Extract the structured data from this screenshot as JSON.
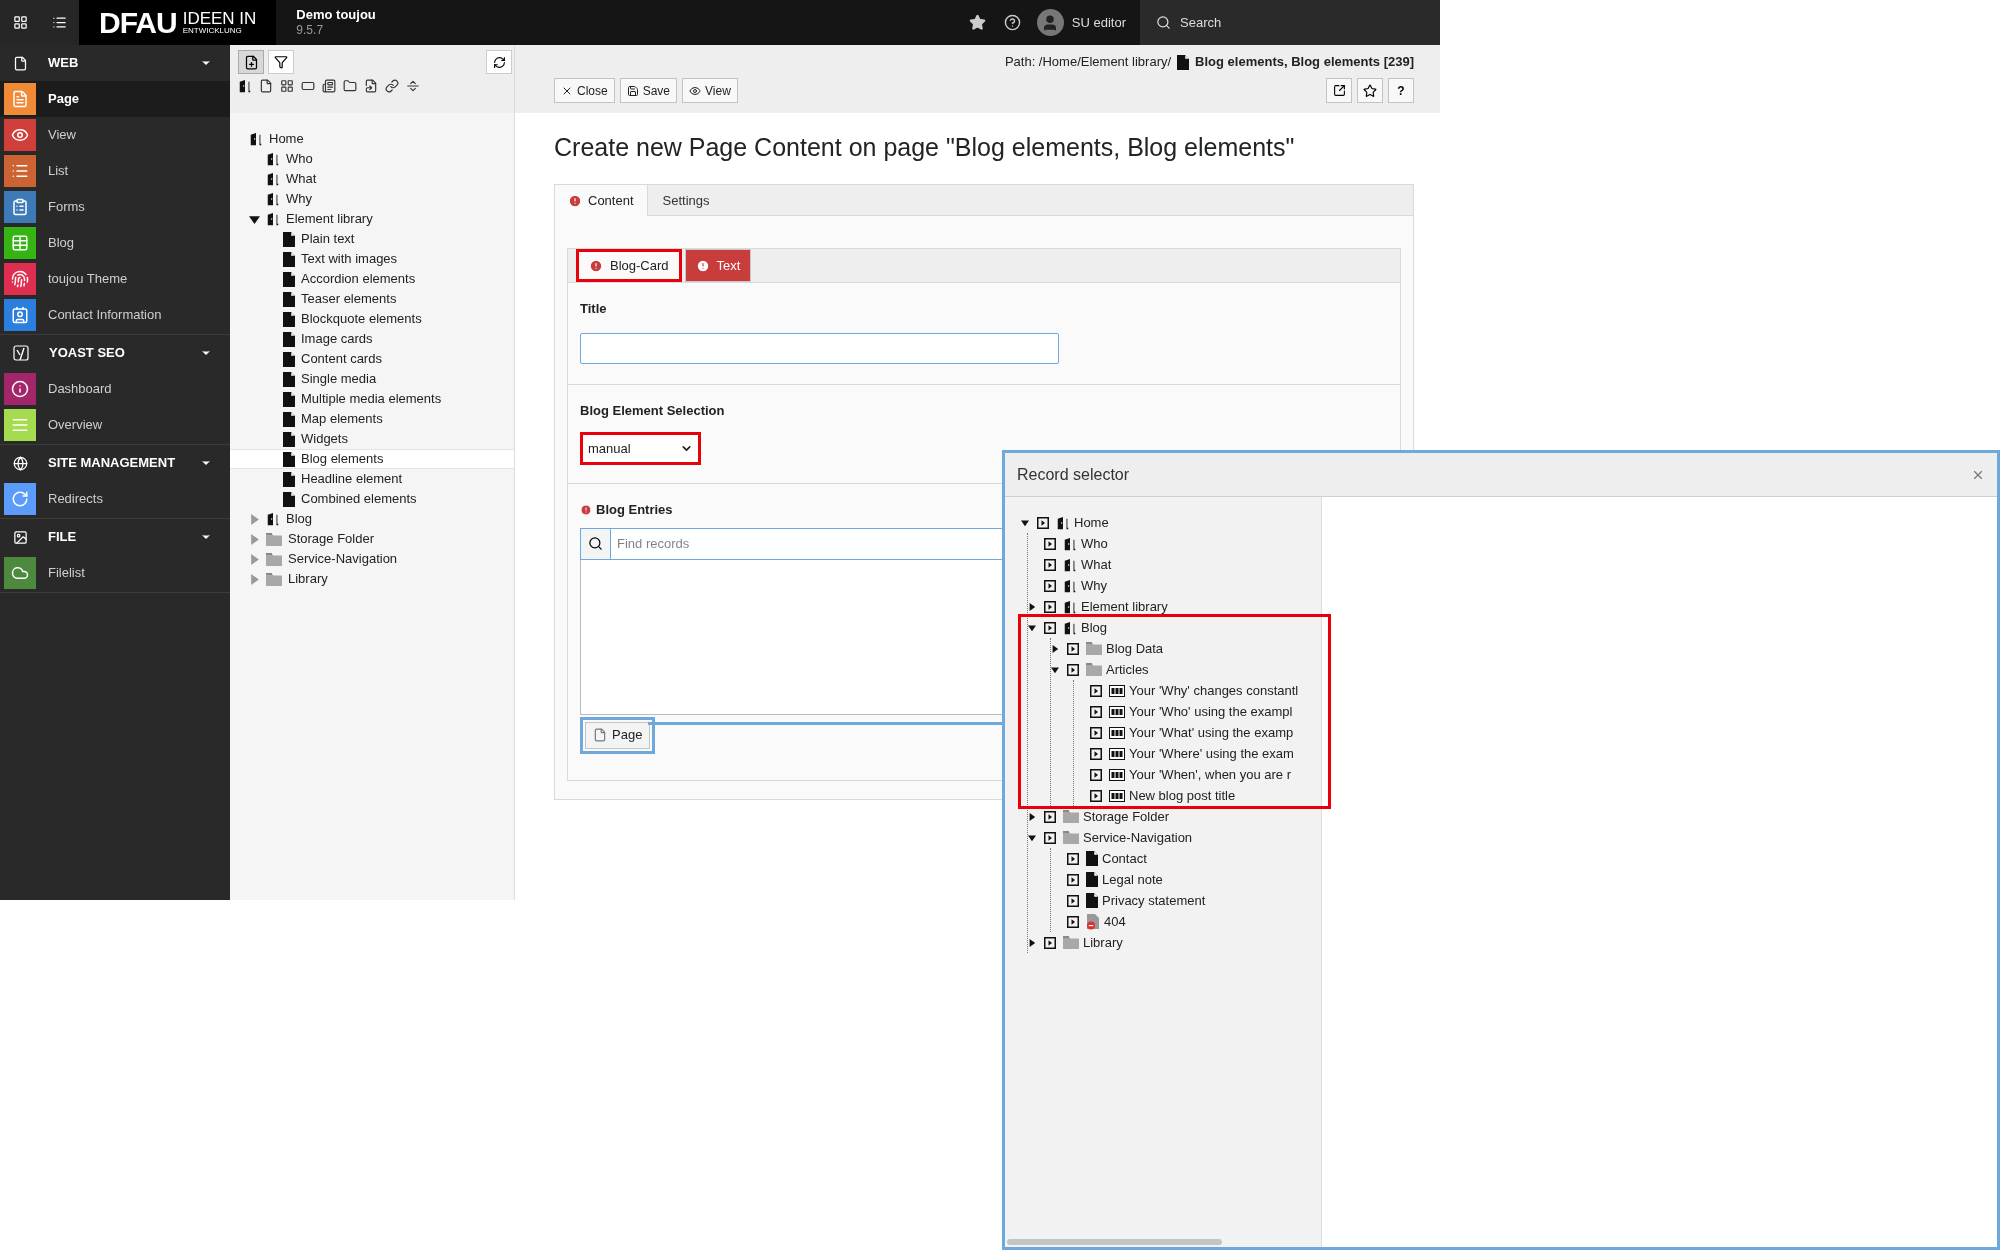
{
  "topbar": {
    "logo": {
      "main": "DFAU",
      "line1": "IDEEN IN",
      "line2": "ENTWICKLUNG"
    },
    "site_name": "Demo toujou",
    "version": "9.5.7",
    "user": "SU editor",
    "search_label": "Search"
  },
  "modules": [
    {
      "title": "WEB",
      "items": [
        {
          "label": "Page",
          "selected": true,
          "color": "#f08a37"
        },
        {
          "label": "View",
          "selected": false,
          "color": "#d13f3a"
        },
        {
          "label": "List",
          "selected": false,
          "color": "#cb6332"
        },
        {
          "label": "Forms",
          "selected": false,
          "color": "#3d7bb8"
        },
        {
          "label": "Blog",
          "selected": false,
          "color": "#35b514"
        },
        {
          "label": "toujou Theme",
          "selected": false,
          "color": "#df2f50"
        },
        {
          "label": "Contact Information",
          "selected": false,
          "color": "#2b7fde"
        }
      ]
    },
    {
      "title": "YOAST SEO",
      "items": [
        {
          "label": "Dashboard",
          "selected": false,
          "color": "#a4266a"
        },
        {
          "label": "Overview",
          "selected": false,
          "color": "#a5dc4f"
        }
      ]
    },
    {
      "title": "SITE MANAGEMENT",
      "items": [
        {
          "label": "Redirects",
          "selected": false,
          "color": "#5b9cfa"
        }
      ]
    },
    {
      "title": "FILE",
      "items": [
        {
          "label": "Filelist",
          "selected": false,
          "color": "#4d8a3d"
        }
      ]
    }
  ],
  "page_tree": [
    {
      "label": "Home",
      "kind": "site",
      "selected": false,
      "children": [
        {
          "label": "Who",
          "kind": "site",
          "selected": false
        },
        {
          "label": "What",
          "kind": "site",
          "selected": false
        },
        {
          "label": "Why",
          "kind": "site",
          "selected": false
        },
        {
          "label": "Element library",
          "kind": "site",
          "selected": false,
          "expanded": true,
          "children": [
            {
              "label": "Plain text",
              "kind": "page",
              "selected": false
            },
            {
              "label": "Text with images",
              "kind": "page",
              "selected": false
            },
            {
              "label": "Accordion elements",
              "kind": "page",
              "selected": false
            },
            {
              "label": "Teaser elements",
              "kind": "page",
              "selected": false
            },
            {
              "label": "Blockquote elements",
              "kind": "page",
              "selected": false
            },
            {
              "label": "Image cards",
              "kind": "page",
              "selected": false
            },
            {
              "label": "Content cards",
              "kind": "page",
              "selected": false
            },
            {
              "label": "Single media",
              "kind": "page",
              "selected": false
            },
            {
              "label": "Multiple media elements",
              "kind": "page",
              "selected": false
            },
            {
              "label": "Map elements",
              "kind": "page",
              "selected": false
            },
            {
              "label": "Widgets",
              "kind": "page",
              "selected": false
            },
            {
              "label": "Blog elements",
              "kind": "page",
              "selected": true
            },
            {
              "label": "Headline element",
              "kind": "page",
              "selected": false
            },
            {
              "label": "Combined elements",
              "kind": "page",
              "selected": false
            }
          ]
        },
        {
          "label": "Blog",
          "kind": "site",
          "selected": false,
          "expanded": false
        },
        {
          "label": "Storage Folder",
          "kind": "folder",
          "selected": false,
          "expanded": false
        },
        {
          "label": "Service-Navigation",
          "kind": "folder",
          "selected": false,
          "expanded": false
        },
        {
          "label": "Library",
          "kind": "folder",
          "selected": false,
          "expanded": false
        }
      ]
    }
  ],
  "docheader": {
    "path": "Path: /Home/Element library/",
    "page_title": "Blog elements, Blog elements [239]",
    "actions": [
      "Close",
      "Save",
      "View"
    ],
    "help_label": "?"
  },
  "form": {
    "heading": "Create new Page Content on page \"Blog elements, Blog elements\"",
    "tabs": [
      {
        "label": "Content",
        "selected": true,
        "error": true
      },
      {
        "label": "Settings",
        "selected": false,
        "error": false
      }
    ],
    "inline_tabs": [
      {
        "label": "Blog-Card",
        "selected": true,
        "error": true,
        "highlighted": true
      },
      {
        "label": "Text",
        "selected": false,
        "error": true,
        "highlighted": false
      }
    ],
    "title_field": {
      "label": "Title"
    },
    "selection_field": {
      "label": "Blog Element Selection",
      "value": "manual",
      "highlighted": true
    },
    "entries_field": {
      "label": "Blog Entries",
      "error": true,
      "placeholder": "Find records",
      "add_button": "Page",
      "linked": true
    }
  },
  "record_selector": {
    "title": "Record selector",
    "tree": [
      {
        "label": "Home",
        "kind": "site",
        "expanded": true,
        "children": [
          {
            "label": "Who",
            "kind": "site"
          },
          {
            "label": "What",
            "kind": "site"
          },
          {
            "label": "Why",
            "kind": "site"
          },
          {
            "label": "Element library",
            "kind": "site",
            "expanded": false
          },
          {
            "label": "Blog",
            "kind": "site",
            "expanded": true,
            "highlighted": true,
            "children": [
              {
                "label": "Blog Data",
                "kind": "folder",
                "expanded": false
              },
              {
                "label": "Articles",
                "kind": "folder",
                "expanded": true,
                "children": [
                  {
                    "label": "Your 'Why' changes constantl",
                    "kind": "record"
                  },
                  {
                    "label": "Your 'Who' using the exampl",
                    "kind": "record"
                  },
                  {
                    "label": "Your 'What' using the examp",
                    "kind": "record"
                  },
                  {
                    "label": "Your 'Where' using the exam",
                    "kind": "record"
                  },
                  {
                    "label": "Your 'When', when you are r",
                    "kind": "record"
                  },
                  {
                    "label": "New blog post title",
                    "kind": "record"
                  }
                ]
              }
            ]
          },
          {
            "label": "Storage Folder",
            "kind": "folder",
            "expanded": false
          },
          {
            "label": "Service-Navigation",
            "kind": "folder",
            "expanded": true,
            "children": [
              {
                "label": "Contact",
                "kind": "page"
              },
              {
                "label": "Legal note",
                "kind": "page"
              },
              {
                "label": "Privacy statement",
                "kind": "page"
              },
              {
                "label": "404",
                "kind": "hidden_page"
              }
            ]
          },
          {
            "label": "Library",
            "kind": "folder",
            "expanded": false
          }
        ]
      }
    ]
  }
}
